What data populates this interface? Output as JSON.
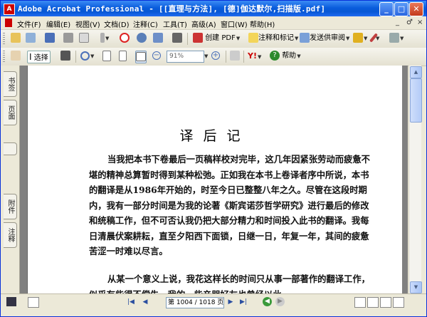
{
  "window": {
    "title": "Adobe Acrobat Professional - [[直理与方法], [德]伽达默尔,扫描版.pdf]",
    "app_icon": "acrobat-icon",
    "controls": {
      "minimize": "_",
      "maximize": "□",
      "close": "✕"
    }
  },
  "menu": {
    "items": [
      "文件(F)",
      "编辑(E)",
      "视图(V)",
      "文档(D)",
      "注释(C)",
      "工具(T)",
      "高级(A)",
      "窗口(W)",
      "帮助(H)"
    ],
    "doc_controls": [
      "_",
      "♂",
      "×"
    ]
  },
  "toolbar1": {
    "create_pdf": "创建 PDF",
    "comment_markup": "注释和标记",
    "send_review": "发送供审阅"
  },
  "toolbar2": {
    "select": "选择",
    "zoom_value": "91%",
    "help": "帮助"
  },
  "left_tabs": [
    "书签",
    "页面",
    "附件",
    "注释"
  ],
  "document": {
    "heading": "译后记",
    "paragraphs": [
      "当我把本书下卷最后一页稿样校对完毕，这几年因紧张劳动而疲惫不堪的精神总算暂时得到某种松弛。正如我在本书上卷译者序中所说，本书的翻译是从1986年开始的，时至今日已整整八年之久。尽管在这段时期内，我有一部分时间是为我的论著《斯宾诺莎哲学研究》进行最后的修改和统稿工作，但不可否认我仍把大部分精力和时间投入此书的翻译。我每日清晨伏案耕耘，直至夕阳西下面锁，日继一日，年复一年，其间的疲惫苦涩一时难以尽言。",
      "从某一个意义上说，我花这样长的时间只从事一部著作的翻译工作，似乎有些得不偿失。我的一些亲朋好友也曾经以此"
    ]
  },
  "status": {
    "page_field": "第 1004 / 1018 页"
  }
}
